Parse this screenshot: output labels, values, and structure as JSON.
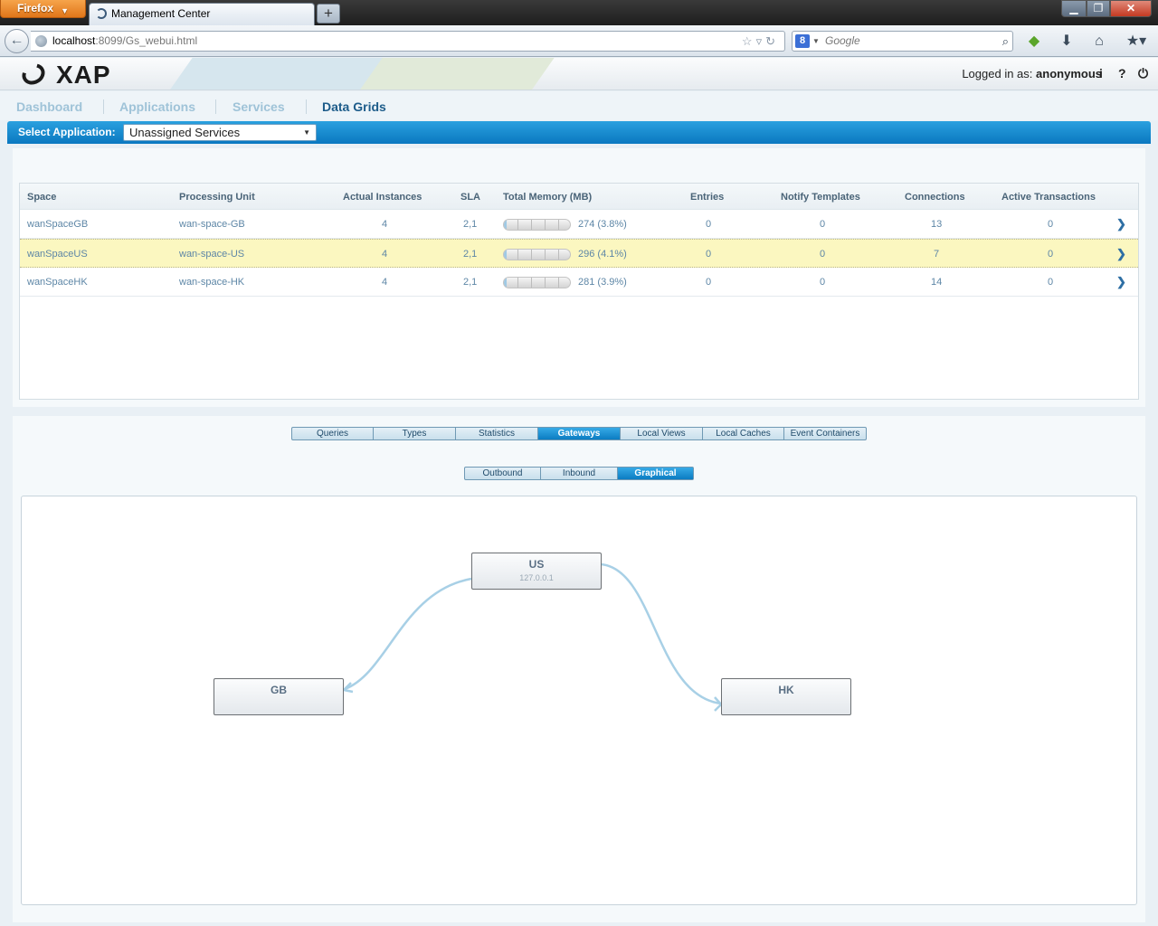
{
  "browser": {
    "menu_label": "Firefox",
    "tab_title": "Management Center",
    "url_host": "localhost",
    "url_rest": ":8099/Gs_webui.html",
    "search_placeholder": "Google"
  },
  "header": {
    "logo_text": "XAP",
    "login_prefix": "Logged in as:",
    "login_user": "anonymous",
    "info_label": "i",
    "help_label": "?"
  },
  "nav": {
    "items": [
      {
        "label": "Dashboard",
        "active": false
      },
      {
        "label": "Applications",
        "active": false
      },
      {
        "label": "Services",
        "active": false
      },
      {
        "label": "Data Grids",
        "active": true
      }
    ]
  },
  "app_bar": {
    "label": "Select Application:",
    "selected": "Unassigned Services"
  },
  "spaces_table": {
    "columns": [
      "Space",
      "Processing Unit",
      "Actual Instances",
      "SLA",
      "Total Memory (MB)",
      "Entries",
      "Notify Templates",
      "Connections",
      "Active Transactions"
    ],
    "rows": [
      {
        "space": "wanSpaceGB",
        "pu": "wan-space-GB",
        "instances": "4",
        "sla": "2,1",
        "memory": "274 (3.8%)",
        "memory_pct": 3.8,
        "entries": "0",
        "notify": "0",
        "connections": "13",
        "transactions": "0",
        "selected": false
      },
      {
        "space": "wanSpaceUS",
        "pu": "wan-space-US",
        "instances": "4",
        "sla": "2,1",
        "memory": "296 (4.1%)",
        "memory_pct": 4.1,
        "entries": "0",
        "notify": "0",
        "connections": "7",
        "transactions": "0",
        "selected": true
      },
      {
        "space": "wanSpaceHK",
        "pu": "wan-space-HK",
        "instances": "4",
        "sla": "2,1",
        "memory": "281 (3.9%)",
        "memory_pct": 3.9,
        "entries": "0",
        "notify": "0",
        "connections": "14",
        "transactions": "0",
        "selected": false
      }
    ],
    "row_arrow": "❯"
  },
  "detail_tabs": {
    "items": [
      "Queries",
      "Types",
      "Statistics",
      "Gateways",
      "Local Views",
      "Local Caches",
      "Event Containers"
    ],
    "active": "Gateways"
  },
  "gateway_tabs": {
    "items": [
      "Outbound",
      "Inbound",
      "Graphical"
    ],
    "active": "Graphical"
  },
  "gateway_graph": {
    "nodes": [
      {
        "id": "US",
        "label": "US",
        "sublabel": "127.0.0.1"
      },
      {
        "id": "GB",
        "label": "GB",
        "sublabel": ""
      },
      {
        "id": "HK",
        "label": "HK",
        "sublabel": ""
      }
    ],
    "edges": [
      {
        "from": "US",
        "to": "GB"
      },
      {
        "from": "US",
        "to": "HK"
      }
    ],
    "edge_color": "#a8d0e6"
  }
}
